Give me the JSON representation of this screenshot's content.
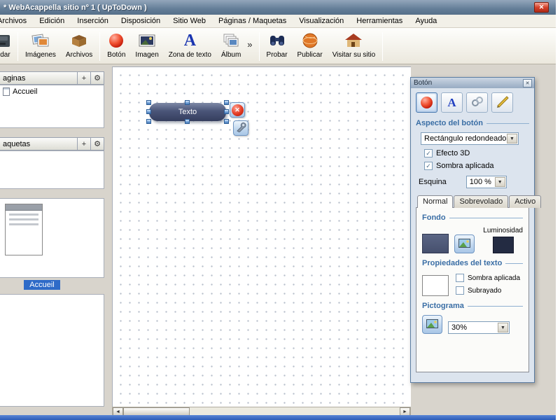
{
  "window": {
    "title": "* WebAcappella sitio nº 1 ( UpToDown )"
  },
  "menu": {
    "items": [
      {
        "label": "Archivos"
      },
      {
        "label": "Edición"
      },
      {
        "label": "Inserción"
      },
      {
        "label": "Disposición"
      },
      {
        "label": "Sitio Web"
      },
      {
        "label": "Páginas / Maquetas"
      },
      {
        "label": "Visualización"
      },
      {
        "label": "Herramientas"
      },
      {
        "label": "Ayuda"
      }
    ]
  },
  "toolbar": {
    "buttons": [
      {
        "label": "ardar"
      },
      {
        "label": "Imágenes"
      },
      {
        "label": "Archivos"
      },
      {
        "label": "Botón"
      },
      {
        "label": "Imagen"
      },
      {
        "label": "Zona de texto"
      },
      {
        "label": "Álbum"
      },
      {
        "label": "Probar"
      },
      {
        "label": "Publicar"
      },
      {
        "label": "Visitar su sitio"
      }
    ]
  },
  "sidebar": {
    "pages_title": "aginas",
    "page_item": "Accueil",
    "layouts_title": "aquetas",
    "thumb_caption": "Accueil"
  },
  "canvas": {
    "selected_button_text": "Texto"
  },
  "panel": {
    "title": "Botón",
    "aspect_title": "Aspecto del botón",
    "shape_value": "Rectángulo redondeado",
    "effect3d_label": "Efecto 3D",
    "shadow_label": "Sombra aplicada",
    "corner_label": "Esquina",
    "corner_value": "100 %",
    "tabs": [
      {
        "label": "Normal"
      },
      {
        "label": "Sobrevolado"
      },
      {
        "label": "Activo"
      }
    ],
    "fondo_title": "Fondo",
    "luminosity_label": "Luminosidad",
    "text_title": "Propiedades del texto",
    "text_shadow_label": "Sombra aplicada",
    "underline_label": "Subrayado",
    "picto_title": "Pictograma",
    "picto_size": "30%"
  },
  "icons": {
    "close": "✕",
    "gear": "⚙",
    "add": "+",
    "chevron": "»",
    "check": "✓",
    "dropdown_arrow": "▼",
    "scroll_left": "◄",
    "scroll_right": "►"
  },
  "colors": {
    "accent_heading": "#3a6ea5",
    "selection_blue": "#2e6bc8",
    "canvas_button_fill": "#4a5578",
    "titlebar": "#647e98"
  }
}
